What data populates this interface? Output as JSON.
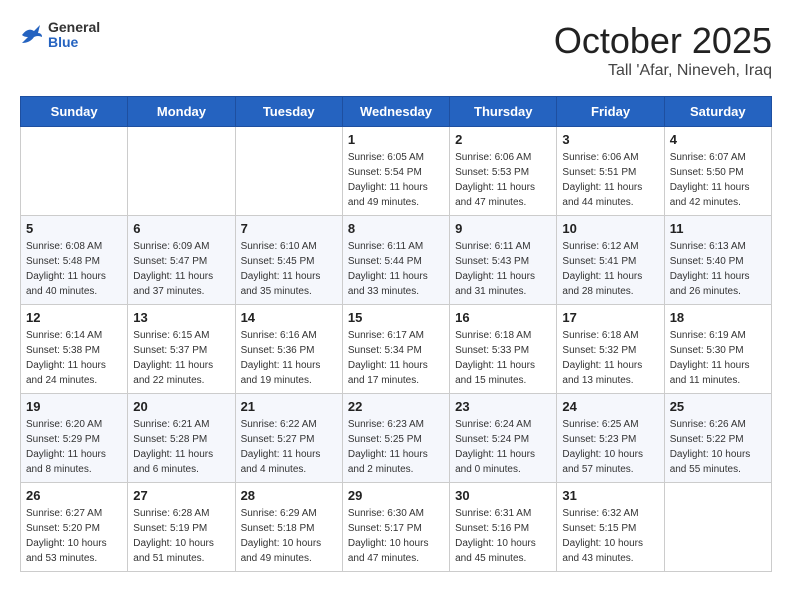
{
  "header": {
    "logo_general": "General",
    "logo_blue": "Blue",
    "month_title": "October 2025",
    "location": "Tall 'Afar, Nineveh, Iraq"
  },
  "weekdays": [
    "Sunday",
    "Monday",
    "Tuesday",
    "Wednesday",
    "Thursday",
    "Friday",
    "Saturday"
  ],
  "weeks": [
    [
      {
        "day": "",
        "info": ""
      },
      {
        "day": "",
        "info": ""
      },
      {
        "day": "",
        "info": ""
      },
      {
        "day": "1",
        "info": "Sunrise: 6:05 AM\nSunset: 5:54 PM\nDaylight: 11 hours\nand 49 minutes."
      },
      {
        "day": "2",
        "info": "Sunrise: 6:06 AM\nSunset: 5:53 PM\nDaylight: 11 hours\nand 47 minutes."
      },
      {
        "day": "3",
        "info": "Sunrise: 6:06 AM\nSunset: 5:51 PM\nDaylight: 11 hours\nand 44 minutes."
      },
      {
        "day": "4",
        "info": "Sunrise: 6:07 AM\nSunset: 5:50 PM\nDaylight: 11 hours\nand 42 minutes."
      }
    ],
    [
      {
        "day": "5",
        "info": "Sunrise: 6:08 AM\nSunset: 5:48 PM\nDaylight: 11 hours\nand 40 minutes."
      },
      {
        "day": "6",
        "info": "Sunrise: 6:09 AM\nSunset: 5:47 PM\nDaylight: 11 hours\nand 37 minutes."
      },
      {
        "day": "7",
        "info": "Sunrise: 6:10 AM\nSunset: 5:45 PM\nDaylight: 11 hours\nand 35 minutes."
      },
      {
        "day": "8",
        "info": "Sunrise: 6:11 AM\nSunset: 5:44 PM\nDaylight: 11 hours\nand 33 minutes."
      },
      {
        "day": "9",
        "info": "Sunrise: 6:11 AM\nSunset: 5:43 PM\nDaylight: 11 hours\nand 31 minutes."
      },
      {
        "day": "10",
        "info": "Sunrise: 6:12 AM\nSunset: 5:41 PM\nDaylight: 11 hours\nand 28 minutes."
      },
      {
        "day": "11",
        "info": "Sunrise: 6:13 AM\nSunset: 5:40 PM\nDaylight: 11 hours\nand 26 minutes."
      }
    ],
    [
      {
        "day": "12",
        "info": "Sunrise: 6:14 AM\nSunset: 5:38 PM\nDaylight: 11 hours\nand 24 minutes."
      },
      {
        "day": "13",
        "info": "Sunrise: 6:15 AM\nSunset: 5:37 PM\nDaylight: 11 hours\nand 22 minutes."
      },
      {
        "day": "14",
        "info": "Sunrise: 6:16 AM\nSunset: 5:36 PM\nDaylight: 11 hours\nand 19 minutes."
      },
      {
        "day": "15",
        "info": "Sunrise: 6:17 AM\nSunset: 5:34 PM\nDaylight: 11 hours\nand 17 minutes."
      },
      {
        "day": "16",
        "info": "Sunrise: 6:18 AM\nSunset: 5:33 PM\nDaylight: 11 hours\nand 15 minutes."
      },
      {
        "day": "17",
        "info": "Sunrise: 6:18 AM\nSunset: 5:32 PM\nDaylight: 11 hours\nand 13 minutes."
      },
      {
        "day": "18",
        "info": "Sunrise: 6:19 AM\nSunset: 5:30 PM\nDaylight: 11 hours\nand 11 minutes."
      }
    ],
    [
      {
        "day": "19",
        "info": "Sunrise: 6:20 AM\nSunset: 5:29 PM\nDaylight: 11 hours\nand 8 minutes."
      },
      {
        "day": "20",
        "info": "Sunrise: 6:21 AM\nSunset: 5:28 PM\nDaylight: 11 hours\nand 6 minutes."
      },
      {
        "day": "21",
        "info": "Sunrise: 6:22 AM\nSunset: 5:27 PM\nDaylight: 11 hours\nand 4 minutes."
      },
      {
        "day": "22",
        "info": "Sunrise: 6:23 AM\nSunset: 5:25 PM\nDaylight: 11 hours\nand 2 minutes."
      },
      {
        "day": "23",
        "info": "Sunrise: 6:24 AM\nSunset: 5:24 PM\nDaylight: 11 hours\nand 0 minutes."
      },
      {
        "day": "24",
        "info": "Sunrise: 6:25 AM\nSunset: 5:23 PM\nDaylight: 10 hours\nand 57 minutes."
      },
      {
        "day": "25",
        "info": "Sunrise: 6:26 AM\nSunset: 5:22 PM\nDaylight: 10 hours\nand 55 minutes."
      }
    ],
    [
      {
        "day": "26",
        "info": "Sunrise: 6:27 AM\nSunset: 5:20 PM\nDaylight: 10 hours\nand 53 minutes."
      },
      {
        "day": "27",
        "info": "Sunrise: 6:28 AM\nSunset: 5:19 PM\nDaylight: 10 hours\nand 51 minutes."
      },
      {
        "day": "28",
        "info": "Sunrise: 6:29 AM\nSunset: 5:18 PM\nDaylight: 10 hours\nand 49 minutes."
      },
      {
        "day": "29",
        "info": "Sunrise: 6:30 AM\nSunset: 5:17 PM\nDaylight: 10 hours\nand 47 minutes."
      },
      {
        "day": "30",
        "info": "Sunrise: 6:31 AM\nSunset: 5:16 PM\nDaylight: 10 hours\nand 45 minutes."
      },
      {
        "day": "31",
        "info": "Sunrise: 6:32 AM\nSunset: 5:15 PM\nDaylight: 10 hours\nand 43 minutes."
      },
      {
        "day": "",
        "info": ""
      }
    ]
  ]
}
